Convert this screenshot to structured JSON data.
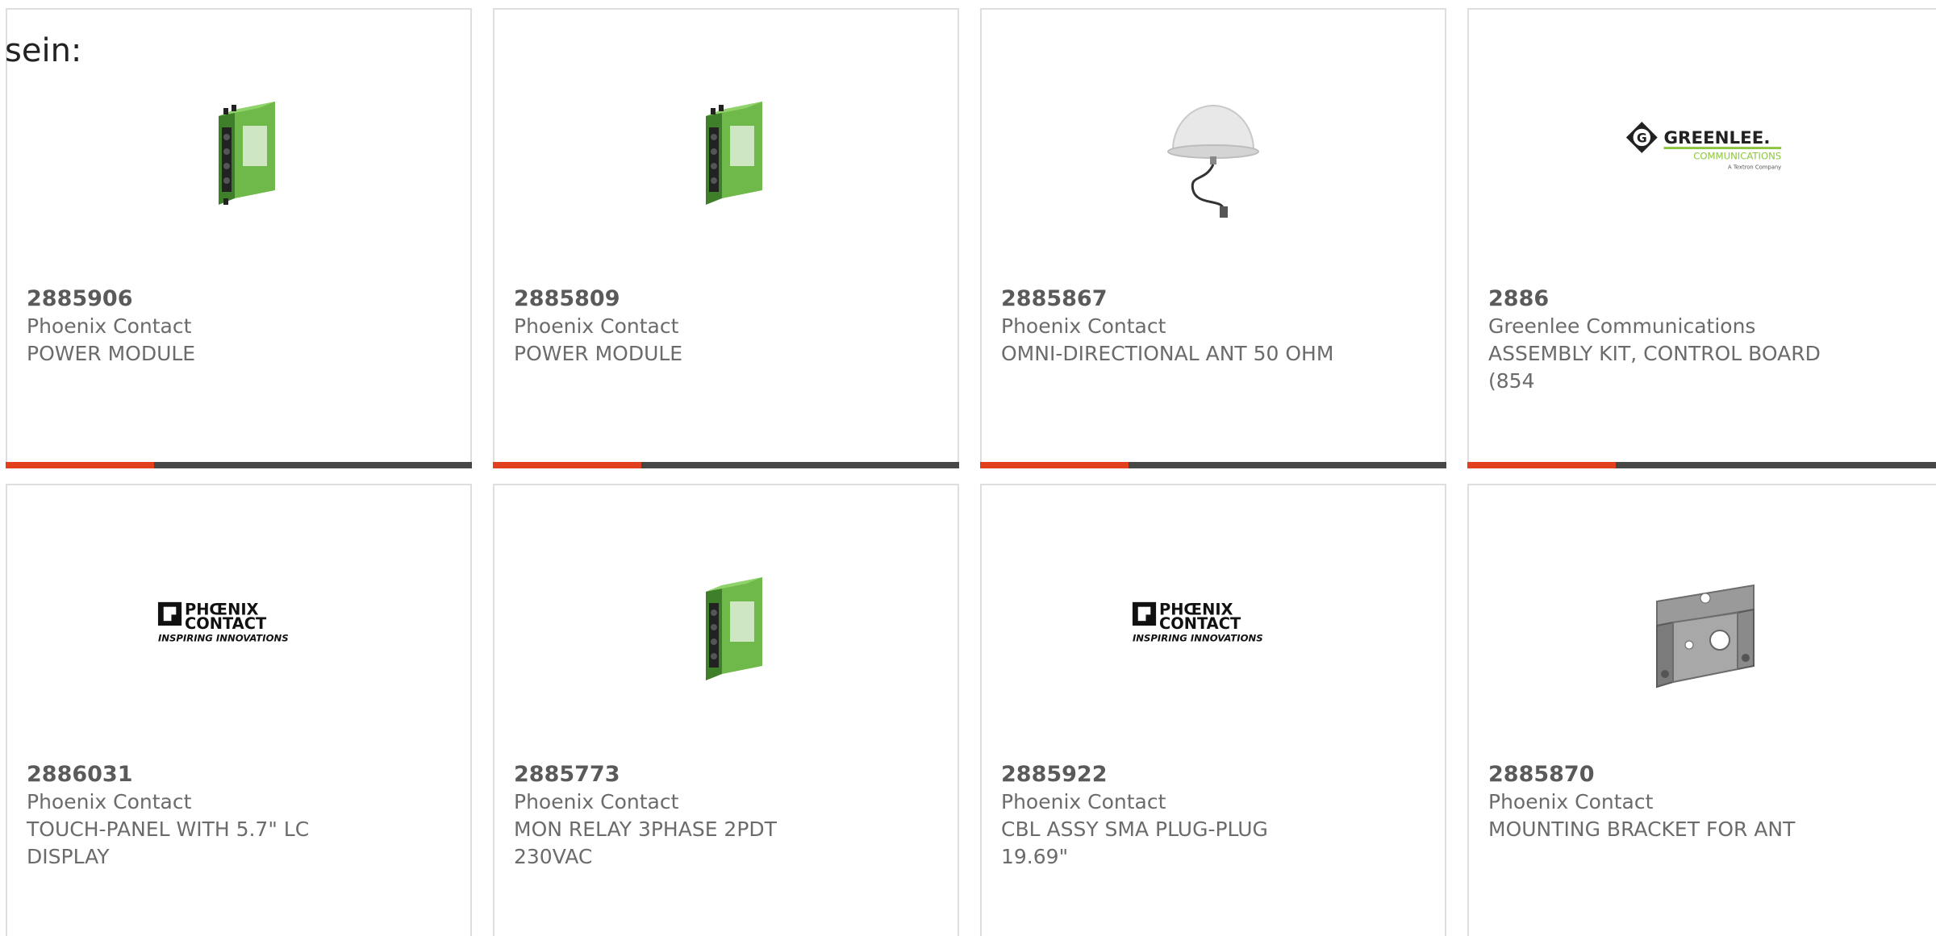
{
  "lead_text": "sein:",
  "colors": {
    "accent": "#e2401c",
    "bar_dark": "#474747",
    "card_border": "#dedede",
    "module_green": "#5aa83a",
    "greenlee_green": "#8cc63f"
  },
  "products": [
    {
      "part_number": "2885906",
      "manufacturer": "Phoenix Contact",
      "description": "POWER MODULE",
      "image": "green-din-rail-module-icon"
    },
    {
      "part_number": "2885809",
      "manufacturer": "Phoenix Contact",
      "description": "POWER MODULE",
      "image": "green-din-rail-module-icon"
    },
    {
      "part_number": "2885867",
      "manufacturer": "Phoenix Contact",
      "description": "OMNI-DIRECTIONAL ANT 50 OHM",
      "image": "dome-antenna-icon"
    },
    {
      "part_number": "2886",
      "manufacturer": "Greenlee Communications",
      "description": "ASSEMBLY KIT, CONTROL BOARD (854",
      "image": "greenlee-logo"
    },
    {
      "part_number": "2886031",
      "manufacturer": "Phoenix Contact",
      "description": "TOUCH-PANEL WITH 5.7\" LC DISPLAY",
      "image": "phoenix-contact-logo"
    },
    {
      "part_number": "2885773",
      "manufacturer": "Phoenix Contact",
      "description": "MON RELAY 3PHASE 2PDT 230VAC",
      "image": "green-din-rail-module-icon"
    },
    {
      "part_number": "2885922",
      "manufacturer": "Phoenix Contact",
      "description": "CBL ASSY SMA PLUG-PLUG 19.69\"",
      "image": "phoenix-contact-logo"
    },
    {
      "part_number": "2885870",
      "manufacturer": "Phoenix Contact",
      "description": "MOUNTING BRACKET FOR ANT",
      "image": "mounting-bracket-icon"
    }
  ],
  "logos": {
    "phoenix_line1": "PHŒNIX",
    "phoenix_line2": "CONTACT",
    "phoenix_tagline": "INSPIRING INNOVATIONS",
    "greenlee_name": "GREENLEE.",
    "greenlee_sub": "COMMUNICATIONS",
    "greenlee_tag": "A Textron Company",
    "greenlee_mark": "G"
  }
}
